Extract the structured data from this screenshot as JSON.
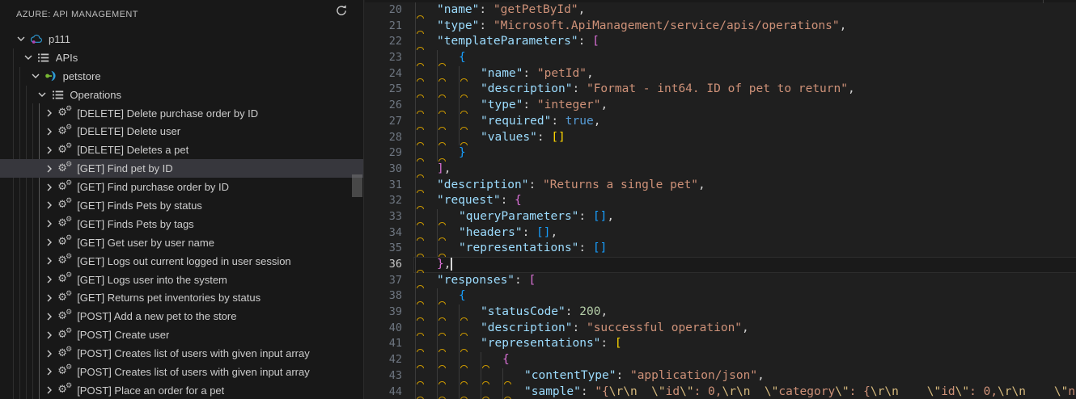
{
  "sidebar": {
    "header": {
      "title": "AZURE: API MANAGEMENT",
      "refresh_icon": "refresh-icon"
    },
    "tree": [
      {
        "label": "p111",
        "icon": "cloud",
        "level": 0,
        "expanded": true
      },
      {
        "label": "APIs",
        "icon": "list",
        "level": 1,
        "expanded": true
      },
      {
        "label": "petstore",
        "icon": "api",
        "level": 2,
        "expanded": true
      },
      {
        "label": "Operations",
        "icon": "list",
        "level": 3,
        "expanded": true
      },
      {
        "label": "[DELETE] Delete purchase order by ID",
        "icon": "gears",
        "level": 4,
        "expanded": false
      },
      {
        "label": "[DELETE] Delete user",
        "icon": "gears",
        "level": 4,
        "expanded": false
      },
      {
        "label": "[DELETE] Deletes a pet",
        "icon": "gears",
        "level": 4,
        "expanded": false
      },
      {
        "label": "[GET] Find pet by ID",
        "icon": "gears",
        "level": 4,
        "expanded": false,
        "selected": true
      },
      {
        "label": "[GET] Find purchase order by ID",
        "icon": "gears",
        "level": 4,
        "expanded": false
      },
      {
        "label": "[GET] Finds Pets by status",
        "icon": "gears",
        "level": 4,
        "expanded": false
      },
      {
        "label": "[GET] Finds Pets by tags",
        "icon": "gears",
        "level": 4,
        "expanded": false
      },
      {
        "label": "[GET] Get user by user name",
        "icon": "gears",
        "level": 4,
        "expanded": false
      },
      {
        "label": "[GET] Logs out current logged in user session",
        "icon": "gears",
        "level": 4,
        "expanded": false
      },
      {
        "label": "[GET] Logs user into the system",
        "icon": "gears",
        "level": 4,
        "expanded": false
      },
      {
        "label": "[GET] Returns pet inventories by status",
        "icon": "gears",
        "level": 4,
        "expanded": false
      },
      {
        "label": "[POST] Add a new pet to the store",
        "icon": "gears",
        "level": 4,
        "expanded": false
      },
      {
        "label": "[POST] Create user",
        "icon": "gears",
        "level": 4,
        "expanded": false
      },
      {
        "label": "[POST] Creates list of users with given input array",
        "icon": "gears",
        "level": 4,
        "expanded": false
      },
      {
        "label": "[POST] Creates list of users with given input array",
        "icon": "gears",
        "level": 4,
        "expanded": false
      },
      {
        "label": "[POST] Place an order for a pet",
        "icon": "gears",
        "level": 4,
        "expanded": false
      }
    ]
  },
  "editor": {
    "language": "json",
    "active_line": 36,
    "first_line": 20,
    "colors": {
      "background": "#1f1f1f",
      "sidebar_background": "#181818",
      "selection_background": "#37373d",
      "key": "#9cdcfe",
      "string": "#ce9178",
      "escape": "#d7ba7d",
      "boolean": "#569cd6",
      "number": "#b5cea8",
      "bracket_gold": "#ffd700",
      "bracket_pink": "#da70d6",
      "bracket_blue": "#179fff",
      "line_number": "#6e7681",
      "active_line_number": "#c6c6c6",
      "whitespace_warning": "#c99700"
    },
    "lines": [
      {
        "n": 20,
        "ind": 1,
        "tk": [
          [
            "key",
            "\"name\""
          ],
          [
            "pun",
            ": "
          ],
          [
            "str",
            "\"getPetById\""
          ],
          [
            "pun",
            ","
          ]
        ]
      },
      {
        "n": 21,
        "ind": 1,
        "tk": [
          [
            "key",
            "\"type\""
          ],
          [
            "pun",
            ": "
          ],
          [
            "str",
            "\"Microsoft.ApiManagement/service/apis/operations\""
          ],
          [
            "pun",
            ","
          ]
        ]
      },
      {
        "n": 22,
        "ind": 1,
        "tk": [
          [
            "key",
            "\"templateParameters\""
          ],
          [
            "pun",
            ": "
          ],
          [
            "b2",
            "["
          ]
        ]
      },
      {
        "n": 23,
        "ind": 2,
        "tk": [
          [
            "b3",
            "{"
          ]
        ]
      },
      {
        "n": 24,
        "ind": 3,
        "tk": [
          [
            "key",
            "\"name\""
          ],
          [
            "pun",
            ": "
          ],
          [
            "str",
            "\"petId\""
          ],
          [
            "pun",
            ","
          ]
        ]
      },
      {
        "n": 25,
        "ind": 3,
        "tk": [
          [
            "key",
            "\"description\""
          ],
          [
            "pun",
            ": "
          ],
          [
            "str",
            "\"Format - int64. ID of pet to return\""
          ],
          [
            "pun",
            ","
          ]
        ]
      },
      {
        "n": 26,
        "ind": 3,
        "tk": [
          [
            "key",
            "\"type\""
          ],
          [
            "pun",
            ": "
          ],
          [
            "str",
            "\"integer\""
          ],
          [
            "pun",
            ","
          ]
        ]
      },
      {
        "n": 27,
        "ind": 3,
        "tk": [
          [
            "key",
            "\"required\""
          ],
          [
            "pun",
            ": "
          ],
          [
            "bool",
            "true"
          ],
          [
            "pun",
            ","
          ]
        ]
      },
      {
        "n": 28,
        "ind": 3,
        "tk": [
          [
            "key",
            "\"values\""
          ],
          [
            "pun",
            ": "
          ],
          [
            "b1",
            "[]"
          ]
        ]
      },
      {
        "n": 29,
        "ind": 2,
        "tk": [
          [
            "b3",
            "}"
          ]
        ]
      },
      {
        "n": 30,
        "ind": 1,
        "tk": [
          [
            "b2",
            "]"
          ],
          [
            "pun",
            ","
          ]
        ]
      },
      {
        "n": 31,
        "ind": 1,
        "tk": [
          [
            "key",
            "\"description\""
          ],
          [
            "pun",
            ": "
          ],
          [
            "str",
            "\"Returns a single pet\""
          ],
          [
            "pun",
            ","
          ]
        ]
      },
      {
        "n": 32,
        "ind": 1,
        "tk": [
          [
            "key",
            "\"request\""
          ],
          [
            "pun",
            ": "
          ],
          [
            "b2",
            "{"
          ]
        ]
      },
      {
        "n": 33,
        "ind": 2,
        "tk": [
          [
            "key",
            "\"queryParameters\""
          ],
          [
            "pun",
            ": "
          ],
          [
            "b3",
            "[]"
          ],
          [
            "pun",
            ","
          ]
        ]
      },
      {
        "n": 34,
        "ind": 2,
        "tk": [
          [
            "key",
            "\"headers\""
          ],
          [
            "pun",
            ": "
          ],
          [
            "b3",
            "[]"
          ],
          [
            "pun",
            ","
          ]
        ]
      },
      {
        "n": 35,
        "ind": 2,
        "tk": [
          [
            "key",
            "\"representations\""
          ],
          [
            "pun",
            ": "
          ],
          [
            "b3",
            "[]"
          ]
        ]
      },
      {
        "n": 36,
        "ind": 1,
        "active": true,
        "cursor": true,
        "tk": [
          [
            "b2",
            "}"
          ],
          [
            "pun",
            ","
          ]
        ]
      },
      {
        "n": 37,
        "ind": 1,
        "tk": [
          [
            "key",
            "\"responses\""
          ],
          [
            "pun",
            ": "
          ],
          [
            "b2",
            "["
          ]
        ]
      },
      {
        "n": 38,
        "ind": 2,
        "tk": [
          [
            "b3",
            "{"
          ]
        ]
      },
      {
        "n": 39,
        "ind": 3,
        "tk": [
          [
            "key",
            "\"statusCode\""
          ],
          [
            "pun",
            ": "
          ],
          [
            "num",
            "200"
          ],
          [
            "pun",
            ","
          ]
        ]
      },
      {
        "n": 40,
        "ind": 3,
        "tk": [
          [
            "key",
            "\"description\""
          ],
          [
            "pun",
            ": "
          ],
          [
            "str",
            "\"successful operation\""
          ],
          [
            "pun",
            ","
          ]
        ]
      },
      {
        "n": 41,
        "ind": 3,
        "tk": [
          [
            "key",
            "\"representations\""
          ],
          [
            "pun",
            ": "
          ],
          [
            "b1",
            "["
          ]
        ]
      },
      {
        "n": 42,
        "ind": 4,
        "tk": [
          [
            "b2",
            "{"
          ]
        ]
      },
      {
        "n": 43,
        "ind": 5,
        "tk": [
          [
            "key",
            "\"contentType\""
          ],
          [
            "pun",
            ": "
          ],
          [
            "str",
            "\"application/json\""
          ],
          [
            "pun",
            ","
          ]
        ]
      },
      {
        "n": 44,
        "ind": 5,
        "tk": [
          [
            "key",
            "\"sample\""
          ],
          [
            "pun",
            ": "
          ],
          [
            "str",
            "\"{"
          ],
          [
            "esc",
            "\\r\\n"
          ],
          [
            "str",
            "  "
          ],
          [
            "esc",
            "\\\""
          ],
          [
            "str",
            "id"
          ],
          [
            "esc",
            "\\\""
          ],
          [
            "str",
            ": 0,"
          ],
          [
            "esc",
            "\\r\\n"
          ],
          [
            "str",
            "  "
          ],
          [
            "esc",
            "\\\""
          ],
          [
            "str",
            "category"
          ],
          [
            "esc",
            "\\\""
          ],
          [
            "str",
            ": {"
          ],
          [
            "esc",
            "\\r\\n"
          ],
          [
            "str",
            "    "
          ],
          [
            "esc",
            "\\\""
          ],
          [
            "str",
            "id"
          ],
          [
            "esc",
            "\\\""
          ],
          [
            "str",
            ": 0,"
          ],
          [
            "esc",
            "\\r\\n"
          ],
          [
            "str",
            "    "
          ],
          [
            "esc",
            "\\\""
          ],
          [
            "str",
            "name"
          ]
        ]
      }
    ]
  }
}
